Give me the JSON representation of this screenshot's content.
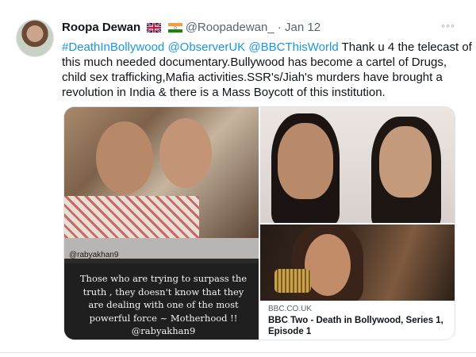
{
  "tweet": {
    "author_name": "Roopa Dewan",
    "flags": [
      "uk-flag-icon",
      "india-flag-icon"
    ],
    "handle": "@Roopadewan_",
    "separator": "·",
    "date": "Jan 12",
    "more_glyph": "◦◦◦",
    "text": {
      "line1": {
        "links": [
          "#DeathInBollywood",
          "@ObserverUK",
          "@BBCThisWorld"
        ],
        "rest": " Thank u 4 the telecast of"
      },
      "line2": "this much needed documentary.Bullywood has become a cartel of Drugs,",
      "line3": "child sex trafficking,Mafia activities.SSR's/Jiah's murders have brought a",
      "line4": "revolution in India & there is a Mass Boycott of this institution."
    }
  },
  "media": {
    "left_photo": {
      "credit": "@rabyakhan9",
      "quote_lines": [
        "Those who are trying to surpass the",
        "truth , they doesn't know that they",
        "are dealing with one of the most",
        "powerful force ~ Motherhood !!",
        "@rabyakhan9"
      ]
    },
    "link_card": {
      "domain": "BBC.CO.UK",
      "title": "BBC Two - Death in Bollywood, Series 1, Episode 1"
    }
  },
  "colors": {
    "link": "#1b95e0",
    "text": "#0f1419",
    "muted": "#536471",
    "border": "#dfe3e6"
  }
}
